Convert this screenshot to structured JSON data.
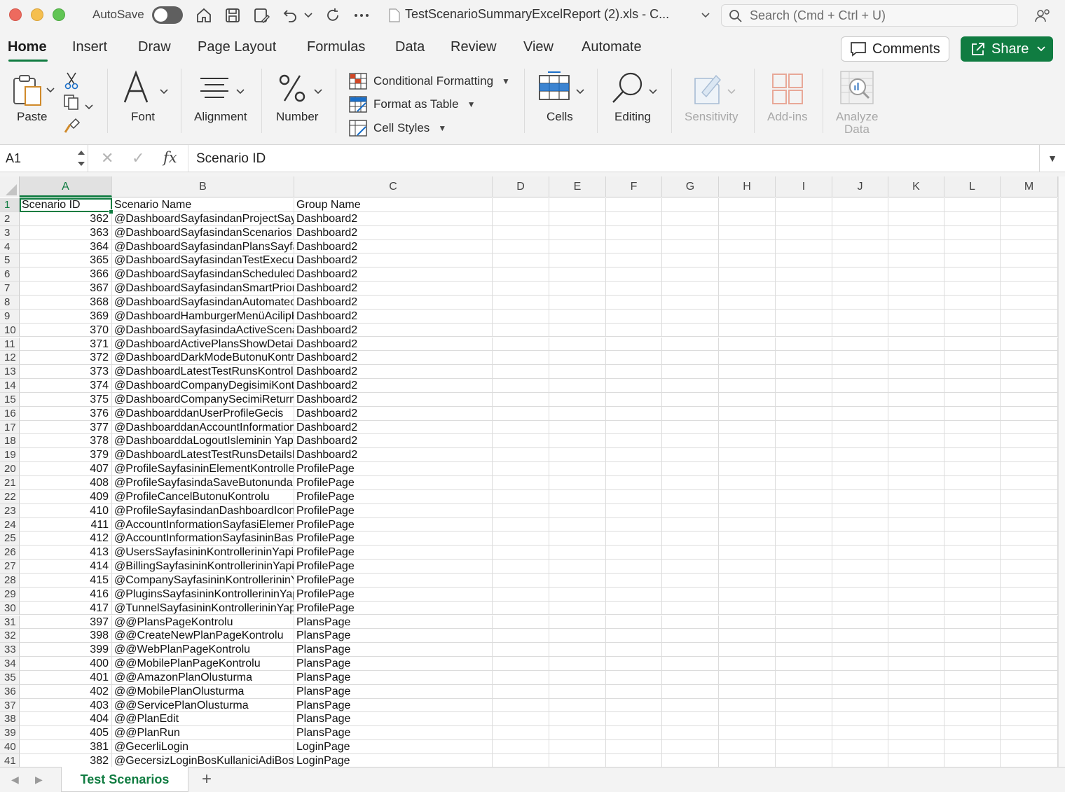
{
  "titlebar": {
    "autosave_label": "AutoSave",
    "doc_title": "TestScenarioSummaryExcelReport (2).xls  -  C...",
    "search_placeholder": "Search (Cmd + Ctrl + U)"
  },
  "tabs": [
    "Home",
    "Insert",
    "Draw",
    "Page Layout",
    "Formulas",
    "Data",
    "Review",
    "View",
    "Automate"
  ],
  "actions": {
    "comments": "Comments",
    "share": "Share"
  },
  "ribbon": {
    "paste": "Paste",
    "font": "Font",
    "alignment": "Alignment",
    "number": "Number",
    "conditional_formatting": "Conditional Formatting",
    "format_as_table": "Format as Table",
    "cell_styles": "Cell Styles",
    "cells": "Cells",
    "editing": "Editing",
    "sensitivity": "Sensitivity",
    "addins": "Add-ins",
    "analyze_line1": "Analyze",
    "analyze_line2": "Data"
  },
  "formula_bar": {
    "name_box": "A1",
    "formula": "Scenario ID"
  },
  "columns": [
    "A",
    "B",
    "C",
    "D",
    "E",
    "F",
    "G",
    "H",
    "I",
    "J",
    "K",
    "L",
    "M"
  ],
  "rows": [
    {
      "n": "1",
      "a": "Scenario ID",
      "b": "Scenario Name",
      "c": "Group Name"
    },
    {
      "n": "2",
      "a": "362",
      "b": "@DashboardSayfasindanProjectSay",
      "c": "Dashboard2"
    },
    {
      "n": "3",
      "a": "363",
      "b": "@DashboardSayfasindanScenarios",
      "c": "Dashboard2"
    },
    {
      "n": "4",
      "a": "364",
      "b": "@DashboardSayfasindanPlansSayfa",
      "c": "Dashboard2"
    },
    {
      "n": "5",
      "a": "365",
      "b": "@DashboardSayfasindanTestExecu",
      "c": "Dashboard2"
    },
    {
      "n": "6",
      "a": "366",
      "b": "@DashboardSayfasindanScheduled",
      "c": "Dashboard2"
    },
    {
      "n": "7",
      "a": "367",
      "b": "@DashboardSayfasindanSmartPrior",
      "c": "Dashboard2"
    },
    {
      "n": "8",
      "a": "368",
      "b": "@DashboardSayfasindanAutomatec",
      "c": "Dashboard2"
    },
    {
      "n": "9",
      "a": "369",
      "b": "@DashboardHamburgerMenüAcilipK",
      "c": "Dashboard2"
    },
    {
      "n": "10",
      "a": "370",
      "b": "@DashboardSayfasindaActiveScena",
      "c": "Dashboard2"
    },
    {
      "n": "11",
      "a": "371",
      "b": "@DashboardActivePlansShowDetail",
      "c": "Dashboard2"
    },
    {
      "n": "12",
      "a": "372",
      "b": "@DashboardDarkModeButonuKontr",
      "c": "Dashboard2"
    },
    {
      "n": "13",
      "a": "373",
      "b": "@DashboardLatestTestRunsKontrol",
      "c": "Dashboard2"
    },
    {
      "n": "14",
      "a": "374",
      "b": "@DashboardCompanyDegisimiKontr",
      "c": "Dashboard2"
    },
    {
      "n": "15",
      "a": "375",
      "b": "@DashboardCompanySecimiReturn",
      "c": "Dashboard2"
    },
    {
      "n": "16",
      "a": "376",
      "b": "@DashboarddanUserProfileGecis",
      "c": "Dashboard2"
    },
    {
      "n": "17",
      "a": "377",
      "b": "@DashboarddanAccountInformation",
      "c": "Dashboard2"
    },
    {
      "n": "18",
      "a": "378",
      "b": "@DashboarddaLogoutIsleminin Yapil",
      "c": "Dashboard2"
    },
    {
      "n": "19",
      "a": "379",
      "b": "@DashboardLatestTestRunsDetailsE",
      "c": "Dashboard2"
    },
    {
      "n": "20",
      "a": "407",
      "b": "@ProfileSayfasininElementKontroller",
      "c": "ProfilePage"
    },
    {
      "n": "21",
      "a": "408",
      "b": "@ProfileSayfasindaSaveButonunda",
      "c": "ProfilePage"
    },
    {
      "n": "22",
      "a": "409",
      "b": "@ProfileCancelButonuKontrolu",
      "c": "ProfilePage"
    },
    {
      "n": "23",
      "a": "410",
      "b": "@ProfileSayfasindanDashboardIcon",
      "c": "ProfilePage"
    },
    {
      "n": "24",
      "a": "411",
      "b": "@AccountInformationSayfasiElemen",
      "c": "ProfilePage"
    },
    {
      "n": "25",
      "a": "412",
      "b": "@AccountInformationSayfasininBasi",
      "c": "ProfilePage"
    },
    {
      "n": "26",
      "a": "413",
      "b": "@UsersSayfasininKontrollerininYapil",
      "c": "ProfilePage"
    },
    {
      "n": "27",
      "a": "414",
      "b": "@BillingSayfasininKontrollerininYapil",
      "c": "ProfilePage"
    },
    {
      "n": "28",
      "a": "415",
      "b": "@CompanySayfasininKontrollerininY",
      "c": "ProfilePage"
    },
    {
      "n": "29",
      "a": "416",
      "b": "@PluginsSayfasininKontrollerininYap",
      "c": "ProfilePage"
    },
    {
      "n": "30",
      "a": "417",
      "b": "@TunnelSayfasininKontrollerininYap",
      "c": "ProfilePage"
    },
    {
      "n": "31",
      "a": "397",
      "b": "@@PlansPageKontrolu",
      "c": "PlansPage"
    },
    {
      "n": "32",
      "a": "398",
      "b": "@@CreateNewPlanPageKontrolu",
      "c": "PlansPage"
    },
    {
      "n": "33",
      "a": "399",
      "b": "@@WebPlanPageKontrolu",
      "c": "PlansPage"
    },
    {
      "n": "34",
      "a": "400",
      "b": "@@MobilePlanPageKontrolu",
      "c": "PlansPage"
    },
    {
      "n": "35",
      "a": "401",
      "b": "@@AmazonPlanOlusturma",
      "c": "PlansPage"
    },
    {
      "n": "36",
      "a": "402",
      "b": "@@MobilePlanOlusturma",
      "c": "PlansPage"
    },
    {
      "n": "37",
      "a": "403",
      "b": "@@ServicePlanOlusturma",
      "c": "PlansPage"
    },
    {
      "n": "38",
      "a": "404",
      "b": "@@PlanEdit",
      "c": "PlansPage"
    },
    {
      "n": "39",
      "a": "405",
      "b": "@@PlanRun",
      "c": "PlansPage"
    },
    {
      "n": "40",
      "a": "381",
      "b": "@GecerliLogin",
      "c": "LoginPage"
    },
    {
      "n": "41",
      "a": "382",
      "b": "@GecersizLoginBosKullaniciAdiBosS",
      "c": "LoginPage"
    }
  ],
  "sheet_tab": "Test Scenarios",
  "colors": {
    "accent": "#107c41"
  }
}
